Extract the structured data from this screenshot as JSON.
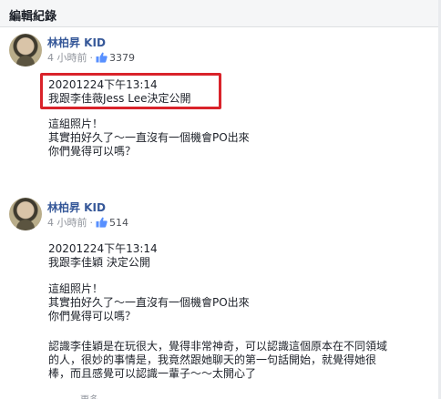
{
  "dialog": {
    "title": "編輯紀錄"
  },
  "revisions": [
    {
      "author": "林柏昇 KID",
      "time": "4 小時前",
      "dot": "·",
      "like_count": "3379",
      "highlighted": [
        "20201224下午13:14",
        "我跟李佳薇Jess Lee決定公開"
      ],
      "lines": [
        "這組照片！",
        "其實拍好久了～一直沒有一個機會PO出來",
        "你們覺得可以嗎？"
      ]
    },
    {
      "author": "林柏昇 KID",
      "time": "4 小時前",
      "dot": "·",
      "like_count": "514",
      "header_lines": [
        "20201224下午13:14",
        "我跟李佳穎 決定公開"
      ],
      "lines": [
        "這組照片！",
        "其實拍好久了～一直沒有一個機會PO出來",
        "你們覺得可以嗎？"
      ],
      "paragraph": "認識李佳穎是在玩很大，覺得非常神奇，可以認識這個原本在不同領域的人，很妙的事情是，我竟然跟她聊天的第一句話開始，就覺得她很棒，而且感覺可以認識一輩子～～太開心了"
    }
  ],
  "footer": {
    "hint": "更多"
  },
  "colors": {
    "author_link": "#365899",
    "highlight_border": "#d9232a",
    "like_blue": "#5890ff"
  },
  "icons": [
    "like-icon"
  ]
}
